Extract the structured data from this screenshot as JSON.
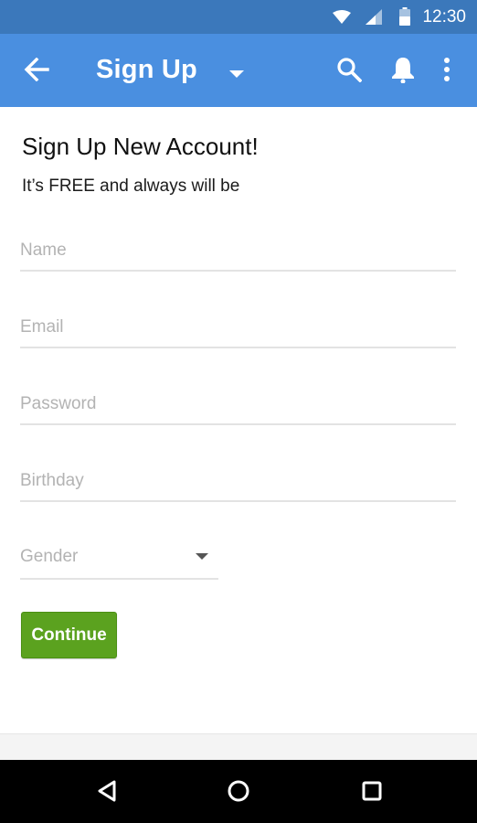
{
  "status_bar": {
    "time": "12:30",
    "icons": [
      "wifi-icon",
      "signal-icon",
      "battery-icon"
    ]
  },
  "app_bar": {
    "title": "Sign Up",
    "icons": [
      "back-arrow-icon",
      "dropdown-caret-icon",
      "search-icon",
      "bell-icon",
      "more-vert-icon"
    ],
    "background": "#4a8fe0",
    "status_background": "#3b78bb"
  },
  "form": {
    "heading": "Sign Up New Account!",
    "subheading": "It’s FREE and always will be",
    "fields": {
      "name": {
        "placeholder": "Name",
        "value": ""
      },
      "email": {
        "placeholder": "Email",
        "value": ""
      },
      "password": {
        "placeholder": "Password",
        "value": ""
      },
      "birthday": {
        "placeholder": "Birthday",
        "value": ""
      }
    },
    "gender": {
      "label": "Gender"
    },
    "continue_label": "Continue",
    "button_color": "#5ba21f"
  },
  "nav_bar": {
    "icons": [
      "back-triangle-icon",
      "home-circle-icon",
      "recents-square-icon"
    ]
  }
}
